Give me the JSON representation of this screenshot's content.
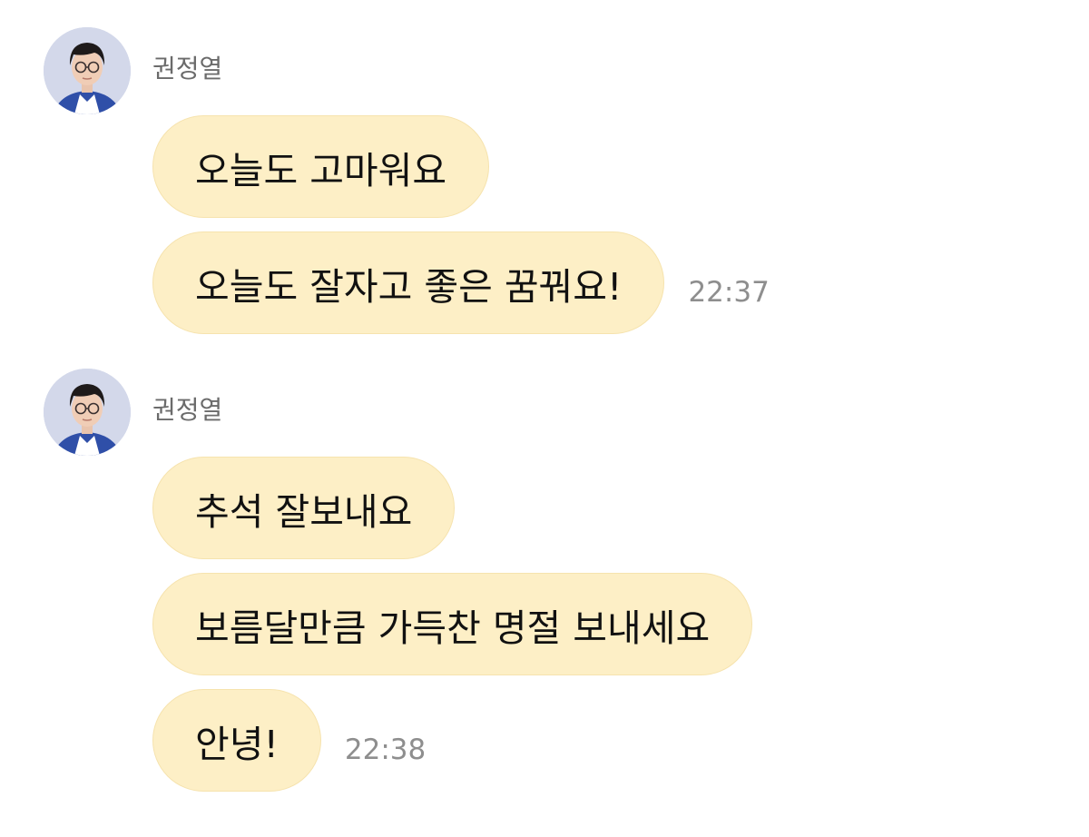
{
  "groups": [
    {
      "sender": "권정열",
      "messages": [
        {
          "text": "오늘도 고마워요",
          "time": ""
        },
        {
          "text": "오늘도 잘자고 좋은 꿈꿔요!",
          "time": "22:37"
        }
      ]
    },
    {
      "sender": "권정열",
      "messages": [
        {
          "text": "추석 잘보내요",
          "time": ""
        },
        {
          "text": "보름달만큼 가득찬 명절 보내세요",
          "time": ""
        },
        {
          "text": "안녕!",
          "time": "22:38"
        }
      ]
    }
  ],
  "colors": {
    "bubble": "#fdefc6",
    "bubble_border": "#f6e3ae",
    "time_text": "#8e8e8e",
    "sender_text": "#6b6b6b"
  },
  "icons": {
    "avatar": "profile-photo-avatar"
  }
}
